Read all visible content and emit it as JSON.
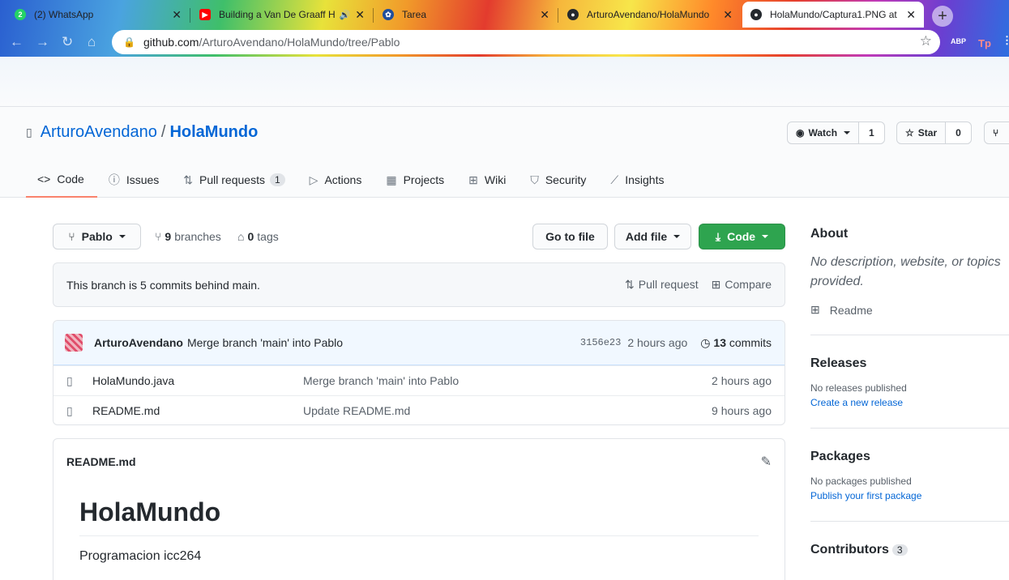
{
  "browser": {
    "tabs": [
      {
        "title": "(2) WhatsApp",
        "favicon_color": "#25d366",
        "favicon_glyph": "2"
      },
      {
        "title": "Building a Van De Graaff H",
        "favicon_color": "#ff0000",
        "favicon_glyph": "▶",
        "audio": true
      },
      {
        "title": "Tarea",
        "favicon_color": "#1f4e9c",
        "favicon_glyph": "✿"
      },
      {
        "title": "ArturoAvendano/HolaMundo",
        "favicon_color": "#24292e",
        "favicon_glyph": "●"
      },
      {
        "title": "HolaMundo/Captura1.PNG at",
        "favicon_color": "#24292e",
        "favicon_glyph": "●",
        "active": true
      }
    ],
    "url_host": "github.com",
    "url_path": "/ArturoAvendano/HolaMundo/tree/Pablo",
    "extensions": [
      "ABP",
      "Tp"
    ]
  },
  "repo": {
    "owner": "ArturoAvendano",
    "separator": "/",
    "name": "HolaMundo",
    "watch_label": "Watch",
    "watch_count": "1",
    "star_label": "Star",
    "star_count": "0"
  },
  "nav": {
    "code": "Code",
    "issues": "Issues",
    "pulls": "Pull requests",
    "pulls_count": "1",
    "actions": "Actions",
    "projects": "Projects",
    "wiki": "Wiki",
    "security": "Security",
    "insights": "Insights"
  },
  "branchbar": {
    "branch": "Pablo",
    "branches_count": "9",
    "branches_label": "branches",
    "tags_count": "0",
    "tags_label": "tags",
    "go_to_file": "Go to file",
    "add_file": "Add file",
    "code_button": "Code"
  },
  "behind": {
    "message": "This branch is 5 commits behind main.",
    "pull_request": "Pull request",
    "compare": "Compare"
  },
  "latest_commit": {
    "author": "ArturoAvendano",
    "message": "Merge branch 'main' into Pablo",
    "sha": "3156e23",
    "age": "2 hours ago",
    "commits_count": "13",
    "commits_label": "commits"
  },
  "files": [
    {
      "name": "HolaMundo.java",
      "message": "Merge branch 'main' into Pablo",
      "age": "2 hours ago"
    },
    {
      "name": "README.md",
      "message": "Update README.md",
      "age": "9 hours ago"
    }
  ],
  "readme": {
    "filename": "README.md",
    "heading": "HolaMundo",
    "body": "Programacion icc264"
  },
  "sidebar": {
    "about_title": "About",
    "about_desc": "No description, website, or topics provided.",
    "readme_link": "Readme",
    "releases_title": "Releases",
    "releases_none": "No releases published",
    "releases_link": "Create a new release",
    "packages_title": "Packages",
    "packages_none": "No packages published",
    "packages_link": "Publish your first package",
    "contributors_title": "Contributors",
    "contributors_count": "3"
  },
  "colors": {
    "link": "#0366d6",
    "primary_button": "#2ea44f",
    "selected_tab_underline": "#f9826c"
  }
}
